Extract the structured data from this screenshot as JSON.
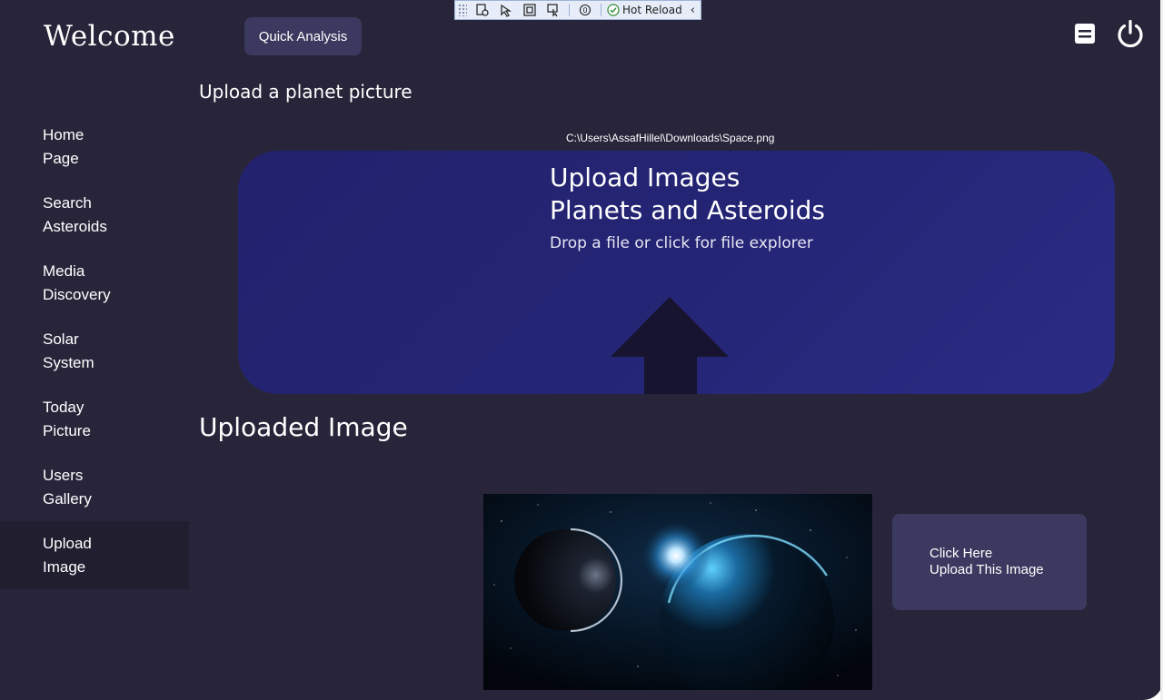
{
  "app": {
    "title": "Welcome"
  },
  "header": {
    "quick_analysis_label": "Quick Analysis"
  },
  "devtoolbar": {
    "hot_reload_label": "Hot Reload"
  },
  "sidebar": {
    "items": [
      {
        "line1": "Home",
        "line2": "Page"
      },
      {
        "line1": "Search",
        "line2": "Asteroids"
      },
      {
        "line1": "Media",
        "line2": "Discovery"
      },
      {
        "line1": "Solar",
        "line2": "System"
      },
      {
        "line1": "Today",
        "line2": "Picture"
      },
      {
        "line1": "Users",
        "line2": "Gallery"
      },
      {
        "line1": "Upload",
        "line2": "Image"
      }
    ],
    "active_item": "Upload Image"
  },
  "main": {
    "section_title": "Upload a planet picture",
    "file_path": "C:\\Users\\AssafHillel\\Downloads\\Space.png",
    "dropzone": {
      "title_line1": "Upload Images",
      "title_line2": "Planets and Asteroids",
      "subtitle": "Drop a file or click for file explorer"
    },
    "uploaded_title": "Uploaded Image",
    "upload_button": {
      "line1": "Click Here",
      "line2": "Upload This Image"
    }
  },
  "colors": {
    "background": "#28253a",
    "button": "#3c3960",
    "dropzone": "#22226e",
    "arrow": "#16142e",
    "active_nav": "#201e2f"
  },
  "icons": [
    "database-icon",
    "power-icon",
    "upload-arrow-icon"
  ]
}
